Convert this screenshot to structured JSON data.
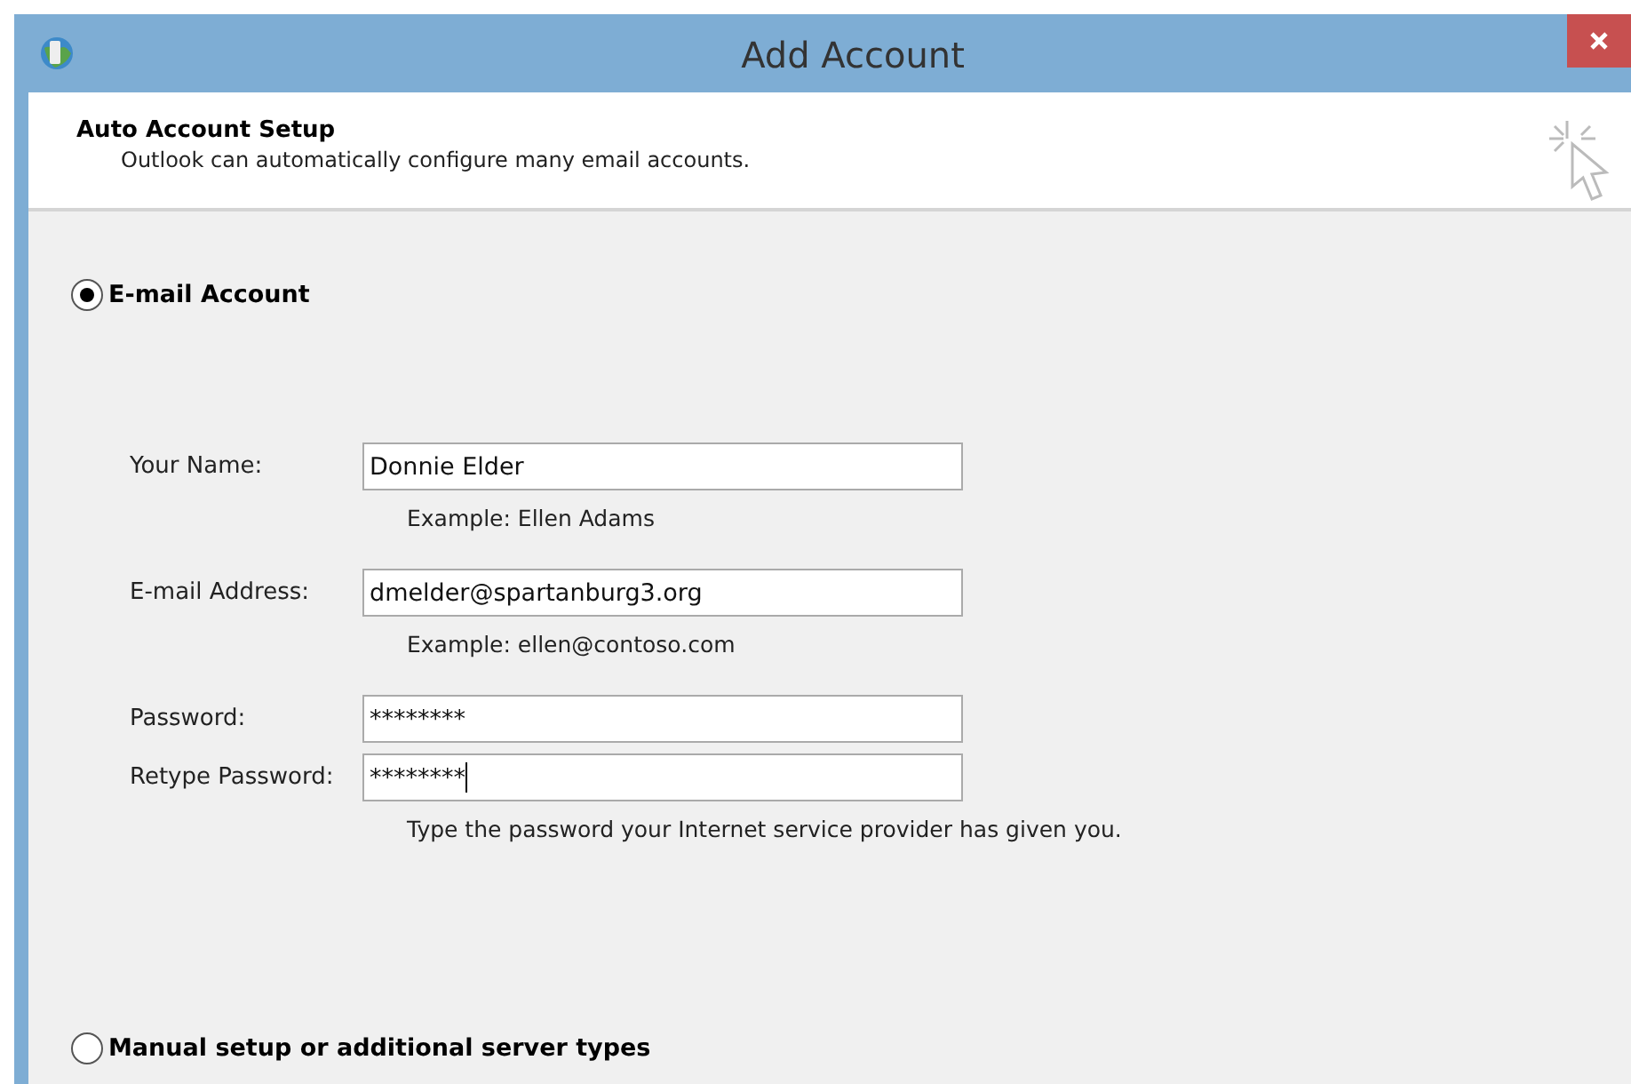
{
  "window": {
    "title": "Add Account"
  },
  "header": {
    "title": "Auto Account Setup",
    "subtitle": "Outlook can automatically configure many email accounts."
  },
  "options": [
    {
      "label": "E-mail Account",
      "selected": true
    },
    {
      "label": "Manual setup or additional server types",
      "selected": false
    }
  ],
  "fields": [
    {
      "label": "Your Name:",
      "value": "Donnie Elder",
      "hint": "Example: Ellen Adams",
      "focused": false
    },
    {
      "label": "E-mail Address:",
      "value": "dmelder@spartanburg3.org",
      "hint": "Example: ellen@contoso.com",
      "focused": false
    },
    {
      "label": "Password:",
      "value": "********",
      "focused": false
    },
    {
      "label": "Retype Password:",
      "value": "********",
      "hint": "Type the password your Internet service provider has given you.",
      "focused": true
    }
  ]
}
